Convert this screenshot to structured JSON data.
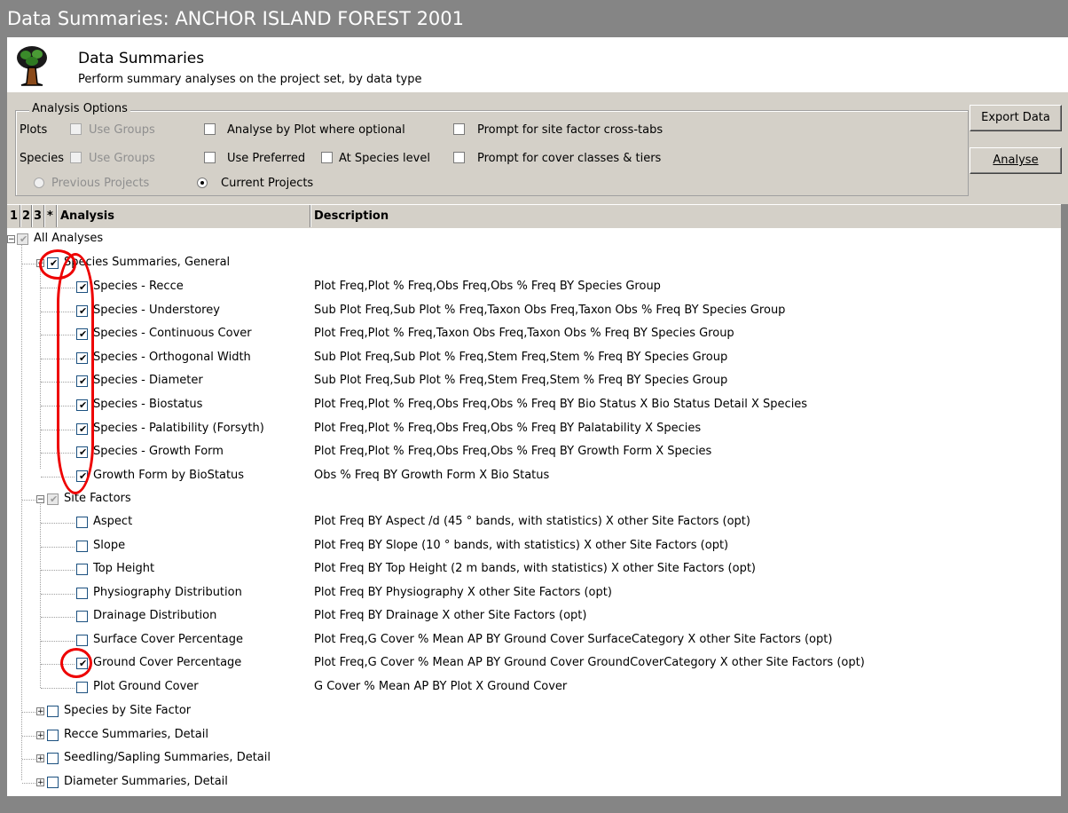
{
  "window": {
    "title": "Data Summaries: ANCHOR ISLAND FOREST 2001"
  },
  "header": {
    "title": "Data Summaries",
    "subtitle": "Perform summary analyses on the project set, by data type",
    "logo_icon": "tree-icon"
  },
  "options": {
    "legend": "Analysis Options",
    "plots_label": "Plots",
    "species_label": "Species",
    "use_groups": "Use Groups",
    "analyse_by_plot": "Analyse by Plot where optional",
    "prompt_site_factor": "Prompt for site factor cross-tabs",
    "use_preferred": "Use Preferred",
    "at_species_level": "At Species level",
    "prompt_cover": "Prompt for cover classes & tiers",
    "previous_projects": "Previous Projects",
    "current_projects": "Current Projects"
  },
  "buttons": {
    "export": "Export Data",
    "analyse": "Analyse"
  },
  "columns": {
    "c1": "1",
    "c2": "2",
    "c3": "3",
    "c4": "*",
    "analysis": "Analysis",
    "description": "Description"
  },
  "tree": {
    "all": "All Analyses",
    "species_general": "Species Summaries, General",
    "species_items": [
      {
        "label": "Species - Recce",
        "desc": "Plot Freq,Plot % Freq,Obs Freq,Obs % Freq BY Species Group"
      },
      {
        "label": "Species - Understorey",
        "desc": "Sub Plot Freq,Sub Plot % Freq,Taxon Obs Freq,Taxon Obs % Freq BY Species Group"
      },
      {
        "label": "Species - Continuous Cover",
        "desc": "Plot Freq,Plot % Freq,Taxon Obs Freq,Taxon Obs % Freq BY Species Group"
      },
      {
        "label": "Species - Orthogonal Width",
        "desc": "Sub Plot Freq,Sub Plot % Freq,Stem Freq,Stem % Freq BY Species Group"
      },
      {
        "label": "Species - Diameter",
        "desc": "Sub Plot Freq,Sub Plot % Freq,Stem Freq,Stem % Freq BY Species Group"
      },
      {
        "label": "Species - Biostatus",
        "desc": "Plot Freq,Plot % Freq,Obs Freq,Obs % Freq BY Bio Status X Bio Status Detail X Species"
      },
      {
        "label": "Species - Palatibility (Forsyth)",
        "desc": "Plot Freq,Plot % Freq,Obs Freq,Obs % Freq BY Palatability X Species"
      },
      {
        "label": "Species - Growth Form",
        "desc": "Plot Freq,Plot % Freq,Obs Freq,Obs % Freq BY Growth Form X Species"
      },
      {
        "label": "Growth Form by BioStatus",
        "desc": "Obs % Freq BY Growth Form X Bio Status"
      }
    ],
    "site_factors": "Site Factors",
    "site_items": [
      {
        "label": "Aspect",
        "desc": "Plot Freq BY Aspect /d (45 ° bands, with statistics) X other Site Factors (opt)"
      },
      {
        "label": "Slope",
        "desc": "Plot Freq BY Slope (10 ° bands, with statistics) X other Site Factors (opt)"
      },
      {
        "label": "Top Height",
        "desc": "Plot Freq BY Top Height (2 m bands, with statistics) X other Site Factors (opt)"
      },
      {
        "label": "Physiography Distribution",
        "desc": "Plot Freq BY Physiography X other Site Factors (opt)"
      },
      {
        "label": "Drainage Distribution",
        "desc": "Plot Freq BY Drainage X other Site Factors (opt)"
      },
      {
        "label": "Surface Cover Percentage",
        "desc": "Plot Freq,G Cover % Mean AP BY Ground Cover SurfaceCategory X other Site Factors (opt)"
      },
      {
        "label": "Ground Cover Percentage",
        "desc": "Plot Freq,G Cover % Mean AP BY Ground Cover GroundCoverCategory X other Site Factors (opt)"
      },
      {
        "label": "Plot Ground Cover",
        "desc": "G Cover % Mean AP BY Plot X Ground Cover"
      }
    ],
    "collapsed": [
      "Species by Site Factor",
      "Recce Summaries, Detail",
      "Seedling/Sapling Summaries, Detail",
      "Diameter Summaries, Detail"
    ]
  },
  "colors": {
    "titlebar": "#858585",
    "highlight_ring": "#e00000"
  }
}
